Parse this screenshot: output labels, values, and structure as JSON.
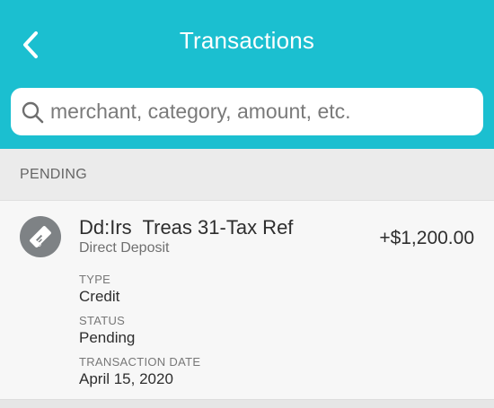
{
  "header": {
    "title": "Transactions",
    "back_icon": "chevron-left-icon",
    "background": "#1bbfd0"
  },
  "search": {
    "placeholder": "merchant, category, amount, etc.",
    "icon": "search-icon"
  },
  "section": {
    "label": "PENDING"
  },
  "transaction": {
    "icon": "deposit-check-icon",
    "merchant": "Dd:Irs  Treas 31-Tax Ref",
    "category": "Direct Deposit",
    "amount": "+$1,200.00",
    "details": {
      "type_label": "TYPE",
      "type_value": "Credit",
      "status_label": "STATUS",
      "status_value": "Pending",
      "date_label": "TRANSACTION DATE",
      "date_value": "April 15, 2020"
    }
  }
}
